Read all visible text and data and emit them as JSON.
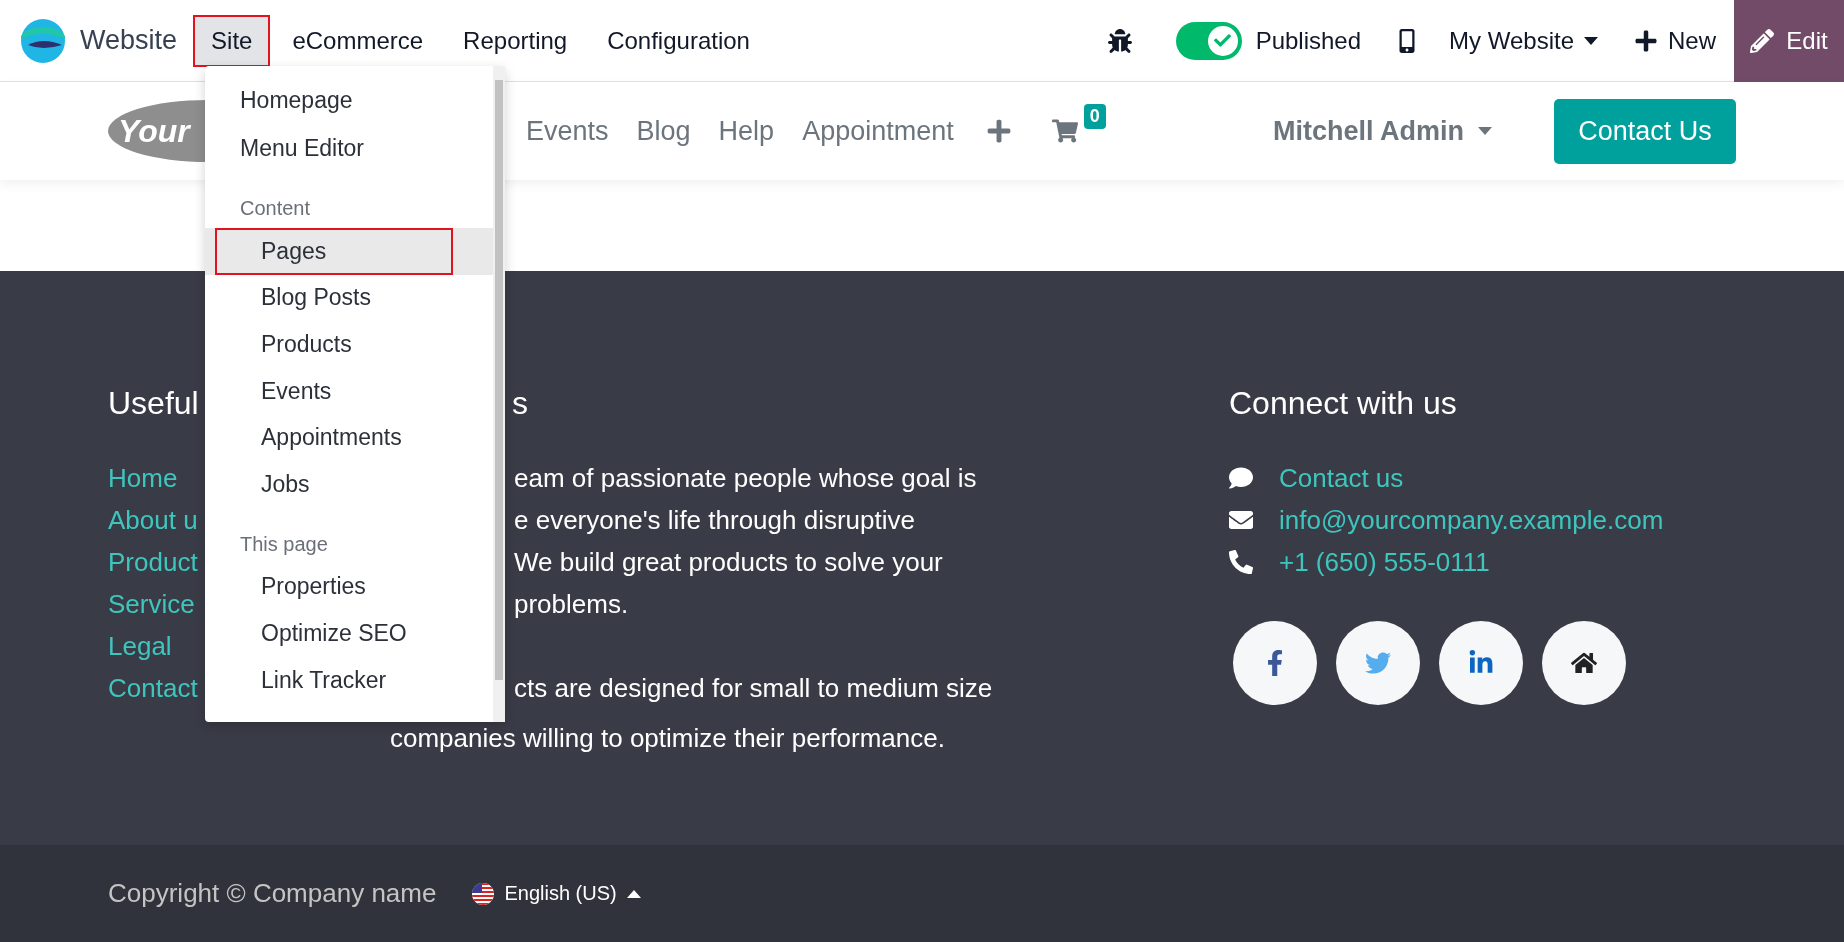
{
  "topbar": {
    "app_name": "Website",
    "menus": [
      {
        "label": "Site",
        "selected": true
      },
      {
        "label": "eCommerce",
        "selected": false
      },
      {
        "label": "Reporting",
        "selected": false
      },
      {
        "label": "Configuration",
        "selected": false
      }
    ],
    "published": {
      "label": "Published",
      "on": true
    },
    "website_switcher": "My Website",
    "new_button": "New",
    "edit_button": "Edit"
  },
  "site_header": {
    "logo_text": "Your",
    "nav": [
      "Events",
      "Blog",
      "Help",
      "Appointment"
    ],
    "cart_count": "0",
    "user": "Mitchell Admin",
    "cta": "Contact Us"
  },
  "dropdown": {
    "sections": [
      {
        "items": [
          {
            "label": "Homepage",
            "selected": false
          },
          {
            "label": "Menu Editor",
            "selected": false
          }
        ]
      },
      {
        "heading": "Content",
        "items": [
          {
            "label": "Pages",
            "selected": true
          },
          {
            "label": "Blog Posts",
            "selected": false
          },
          {
            "label": "Products",
            "selected": false
          },
          {
            "label": "Events",
            "selected": false
          },
          {
            "label": "Appointments",
            "selected": false
          },
          {
            "label": "Jobs",
            "selected": false
          }
        ]
      },
      {
        "heading": "This page",
        "items": [
          {
            "label": "Properties",
            "selected": false
          },
          {
            "label": "Optimize SEO",
            "selected": false
          },
          {
            "label": "Link Tracker",
            "selected": false
          }
        ]
      }
    ]
  },
  "footer": {
    "useful_links": {
      "heading": "Useful",
      "links": [
        "Home",
        "About u",
        "Product",
        "Service",
        "Legal",
        "Contact"
      ]
    },
    "about": {
      "heading": "s",
      "lines": [
        {
          "kind": "partial",
          "text": "eam of passionate people whose goal is"
        },
        {
          "kind": "partial",
          "text": "e everyone's life through disruptive"
        },
        {
          "kind": "partial",
          "text": "We build great products to solve your"
        },
        {
          "kind": "partial",
          "text": "problems."
        },
        {
          "kind": "gap"
        },
        {
          "kind": "partial",
          "text": "cts are designed for small to medium size"
        },
        {
          "kind": "full",
          "text": "companies willing to optimize their performance."
        }
      ]
    },
    "connect": {
      "heading": "Connect with us",
      "contacts": [
        {
          "kind": "chat",
          "text": "Contact us"
        },
        {
          "kind": "email",
          "text": "info@yourcompany.example.com"
        },
        {
          "kind": "phone",
          "text": "+1 (650) 555-0111"
        }
      ],
      "socials": [
        {
          "kind": "facebook"
        },
        {
          "kind": "twitter"
        },
        {
          "kind": "linkedin"
        },
        {
          "kind": "home"
        }
      ]
    }
  },
  "bottom_bar": {
    "copyright": "Copyright © Company name",
    "language": "English (US)"
  }
}
